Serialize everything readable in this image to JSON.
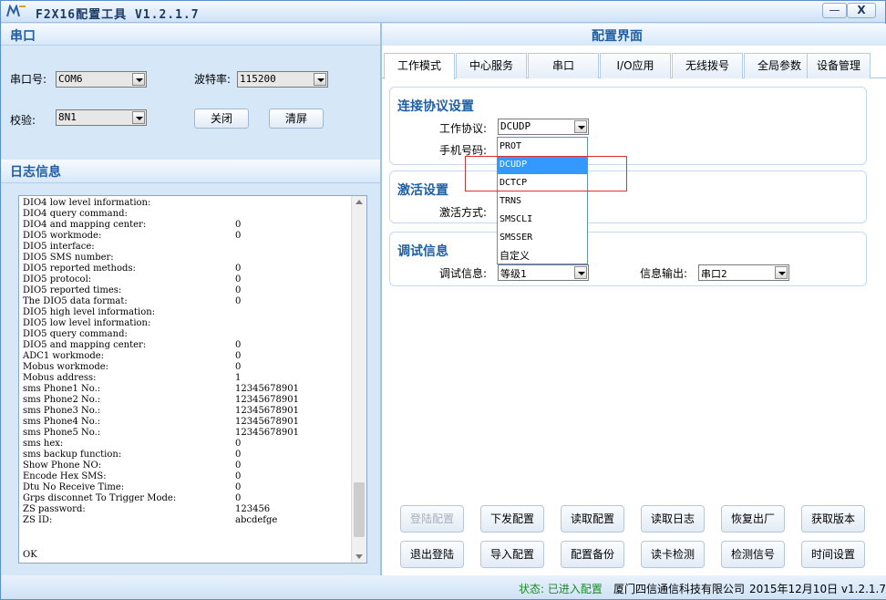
{
  "window": {
    "title": "F2X16配置工具 V1.2.1.7",
    "minimize_label": "—",
    "close_label": "X"
  },
  "serial": {
    "header": "串口",
    "port_label": "串口号:",
    "port_value": "COM6",
    "baud_label": "波特率:",
    "baud_value": "115200",
    "parity_label": "校验:",
    "parity_value": "8N1",
    "close_button": "关闭",
    "clear_button": "清屏"
  },
  "log": {
    "header": "日志信息",
    "lines": [
      {
        "k": "DIO4 low level information:",
        "v": ""
      },
      {
        "k": "DIO4 query command:",
        "v": ""
      },
      {
        "k": "DIO4 and mapping center:",
        "v": "0"
      },
      {
        "k": "DIO5 workmode:",
        "v": "0"
      },
      {
        "k": "DIO5 interface:",
        "v": ""
      },
      {
        "k": "DIO5 SMS number:",
        "v": ""
      },
      {
        "k": "DIO5 reported methods:",
        "v": "0"
      },
      {
        "k": "DIO5 protocol:",
        "v": "0"
      },
      {
        "k": "DIO5 reported times:",
        "v": "0"
      },
      {
        "k": "The DIO5 data format:",
        "v": "0"
      },
      {
        "k": "DIO5 high level information:",
        "v": ""
      },
      {
        "k": "DIO5 low level information:",
        "v": ""
      },
      {
        "k": "DIO5 query command:",
        "v": ""
      },
      {
        "k": "DIO5 and mapping center:",
        "v": "0"
      },
      {
        "k": "ADC1 workmode:",
        "v": "0"
      },
      {
        "k": "Mobus workmode:",
        "v": "0"
      },
      {
        "k": "Mobus address:",
        "v": "1"
      },
      {
        "k": "sms Phone1 No.:",
        "v": "12345678901"
      },
      {
        "k": "sms Phone2 No.:",
        "v": "12345678901"
      },
      {
        "k": "sms Phone3 No.:",
        "v": "12345678901"
      },
      {
        "k": "sms Phone4 No.:",
        "v": "12345678901"
      },
      {
        "k": "sms Phone5 No.:",
        "v": "12345678901"
      },
      {
        "k": "sms hex:",
        "v": "0"
      },
      {
        "k": "sms backup function:",
        "v": "0"
      },
      {
        "k": "Show Phone NO:",
        "v": "0"
      },
      {
        "k": "Encode Hex SMS:",
        "v": "0"
      },
      {
        "k": "Dtu No Receive Time:",
        "v": "0"
      },
      {
        "k": "Grps disconnet To Trigger Mode:",
        "v": "0"
      },
      {
        "k": "ZS password:",
        "v": "123456"
      },
      {
        "k": "ZS ID:",
        "v": "abcdefge"
      }
    ],
    "last_line": "OK"
  },
  "config": {
    "title": "配置界面",
    "tabs": [
      "工作模式",
      "中心服务",
      "串口",
      "I/O应用",
      "无线拨号",
      "全局参数",
      "设备管理"
    ],
    "connection": {
      "title": "连接协议设置",
      "protocol_label": "工作协议:",
      "protocol_value": "DCUDP",
      "phone_label": "手机号码:"
    },
    "protocol_options": [
      "PROT",
      "DCUDP",
      "DCTCP",
      "TRNS",
      "SMSCLI",
      "SMSSER",
      "自定义"
    ],
    "activation": {
      "title": "激活设置",
      "mode_label": "激活方式:"
    },
    "debug": {
      "title": "调试信息",
      "level_label": "调试信息:",
      "level_value": "等级1",
      "output_label": "信息输出:",
      "output_value": "串口2"
    }
  },
  "actions": {
    "row1": [
      "登陆配置",
      "下发配置",
      "读取配置",
      "读取日志",
      "恢复出厂",
      "获取版本"
    ],
    "row2": [
      "退出登陆",
      "导入配置",
      "配置备份",
      "读卡检测",
      "检测信号",
      "时间设置"
    ]
  },
  "status": {
    "text": "状态: 已进入配置",
    "company": "厦门四信通信科技有限公司",
    "date_version": "2015年12月10日  v1.2.1.7"
  }
}
